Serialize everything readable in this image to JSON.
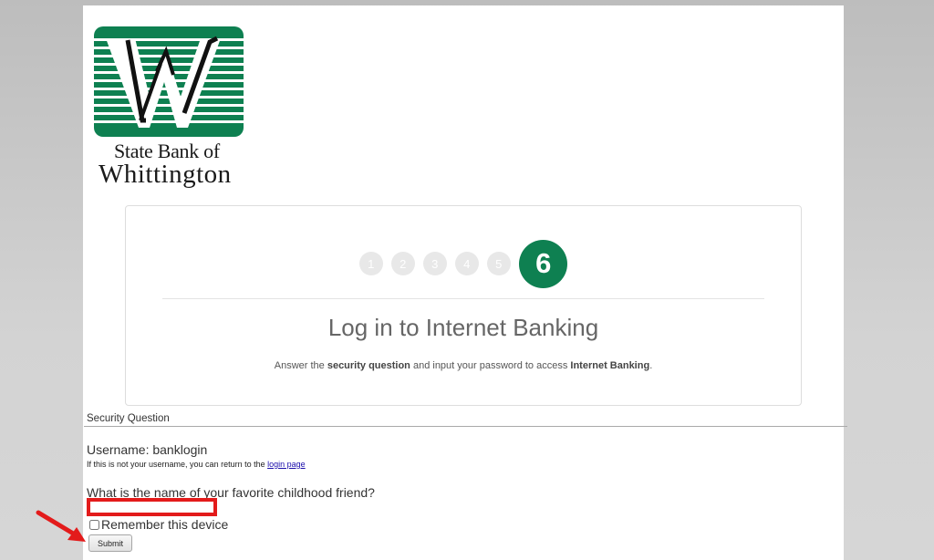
{
  "bank": {
    "name_line1": "State Bank of",
    "name_line2": "Whittington",
    "brand_color": "#0e8051"
  },
  "steps": {
    "items": [
      "1",
      "2",
      "3",
      "4",
      "5",
      "6"
    ],
    "current": "6",
    "total": 6
  },
  "card": {
    "title": "Log in to Internet Banking",
    "desc_part1": "Answer the ",
    "desc_bold1": "security question",
    "desc_part2": " and input your password to access ",
    "desc_bold2": "Internet Banking",
    "desc_part3": "."
  },
  "form": {
    "section_label": "Security Question",
    "username_label": "Username: banklogin",
    "note_text": "If this is not your username, you can return to the ",
    "note_link": "login page",
    "question": "What is the name of your favorite childhood friend?",
    "answer_value": "",
    "answer_placeholder": "",
    "remember_label": "Remember this device",
    "remember_checked": false,
    "submit_label": "Submit"
  },
  "annotations": {
    "highlight_color": "#e31b1b",
    "arrow_color": "#e31b1b"
  }
}
